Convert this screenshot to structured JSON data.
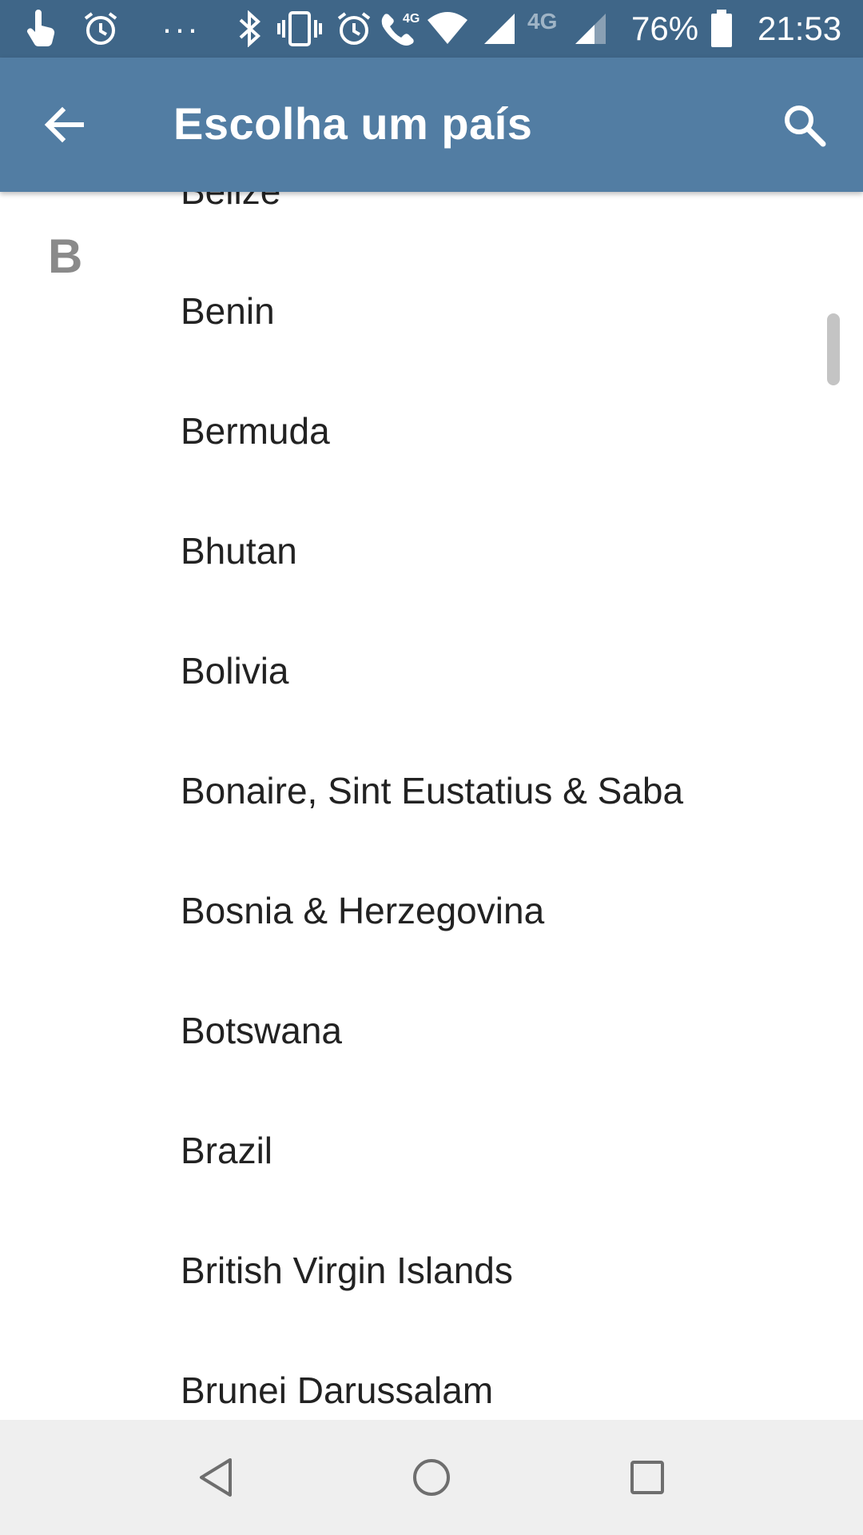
{
  "status_bar": {
    "battery_text": "76%",
    "time": "21:53",
    "network_label": "4G",
    "network_label_2": "4G",
    "overflow": "···",
    "icons": [
      "touch-icon",
      "alarm-icon",
      "bluetooth-icon",
      "vibrate-icon",
      "alarm-icon",
      "volte-call-icon",
      "wifi-icon",
      "signal-icon",
      "signal-icon",
      "battery-icon"
    ],
    "background_color": "#3f6688"
  },
  "app_bar": {
    "title": "Escolha um país",
    "back_icon": "arrow-back-icon",
    "search_icon": "search-icon",
    "background_color": "#527da3"
  },
  "list": {
    "section_letter": "B",
    "items": [
      {
        "label": "Belize"
      },
      {
        "label": "Benin"
      },
      {
        "label": "Bermuda"
      },
      {
        "label": "Bhutan"
      },
      {
        "label": "Bolivia"
      },
      {
        "label": "Bonaire, Sint Eustatius & Saba"
      },
      {
        "label": "Bosnia & Herzegovina"
      },
      {
        "label": "Botswana"
      },
      {
        "label": "Brazil"
      },
      {
        "label": "British Virgin Islands"
      },
      {
        "label": "Brunei Darussalam"
      }
    ]
  },
  "nav_bar": {
    "icons": [
      "nav-back-icon",
      "home-icon",
      "recents-icon"
    ],
    "background_color": "#efefef"
  }
}
